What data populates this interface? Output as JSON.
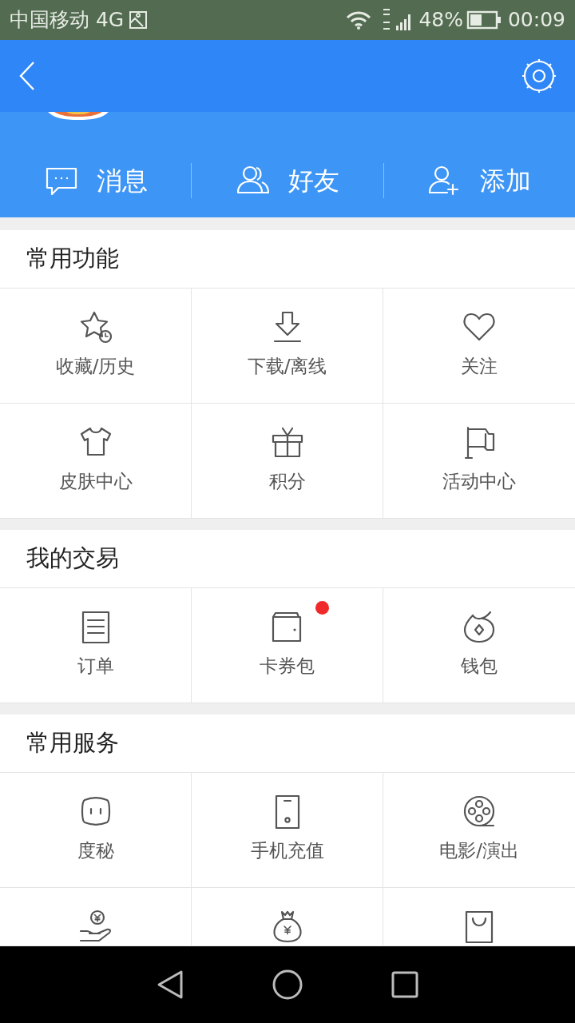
{
  "status_bar": {
    "carrier": "中国移动 4G",
    "battery": "48%",
    "time": "00:09"
  },
  "actions": [
    {
      "label": "消息"
    },
    {
      "label": "好友"
    },
    {
      "label": "添加"
    }
  ],
  "sections": [
    {
      "title": "常用功能",
      "items": [
        {
          "label": "收藏/历史",
          "badge": false
        },
        {
          "label": "下载/离线",
          "badge": false
        },
        {
          "label": "关注",
          "badge": false
        },
        {
          "label": "皮肤中心",
          "badge": false
        },
        {
          "label": "积分",
          "badge": false
        },
        {
          "label": "活动中心",
          "badge": false
        }
      ]
    },
    {
      "title": "我的交易",
      "items": [
        {
          "label": "订单",
          "badge": false
        },
        {
          "label": "卡券包",
          "badge": true
        },
        {
          "label": "钱包",
          "badge": false
        }
      ]
    },
    {
      "title": "常用服务",
      "items": [
        {
          "label": "度秘",
          "badge": false
        },
        {
          "label": "手机充值",
          "badge": false
        },
        {
          "label": "电影/演出",
          "badge": false
        },
        {
          "badge": false
        },
        {
          "badge": false
        },
        {
          "badge": false
        }
      ]
    }
  ]
}
